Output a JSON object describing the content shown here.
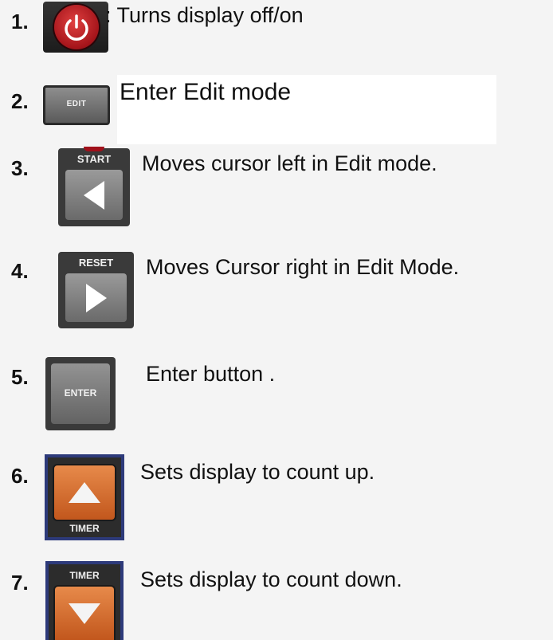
{
  "items": [
    {
      "number": "1.",
      "description": ": Turns display off/on",
      "icon": "power-icon"
    },
    {
      "number": "2.",
      "description": "Enter Edit mode",
      "button_label": "EDIT"
    },
    {
      "number": "3.",
      "description": "Moves cursor left in Edit mode.",
      "button_label": "START",
      "icon": "arrow-left-icon"
    },
    {
      "number": "4.",
      "description": "Moves Cursor right in Edit Mode.",
      "button_label": "RESET",
      "icon": "arrow-right-icon"
    },
    {
      "number": "5.",
      "description": "Enter button .",
      "button_label": "ENTER"
    },
    {
      "number": "6.",
      "description": "Sets display to count up.",
      "button_label": "TIMER",
      "icon": "arrow-up-icon"
    },
    {
      "number": "7.",
      "description": "Sets display to count down.",
      "button_label": "TIMER",
      "icon": "arrow-down-icon"
    }
  ],
  "colors": {
    "background": "#f4f4f4",
    "power_red": "#c41e24",
    "timer_orange": "#d86a2c",
    "timer_border_blue": "#2d3a7a"
  }
}
